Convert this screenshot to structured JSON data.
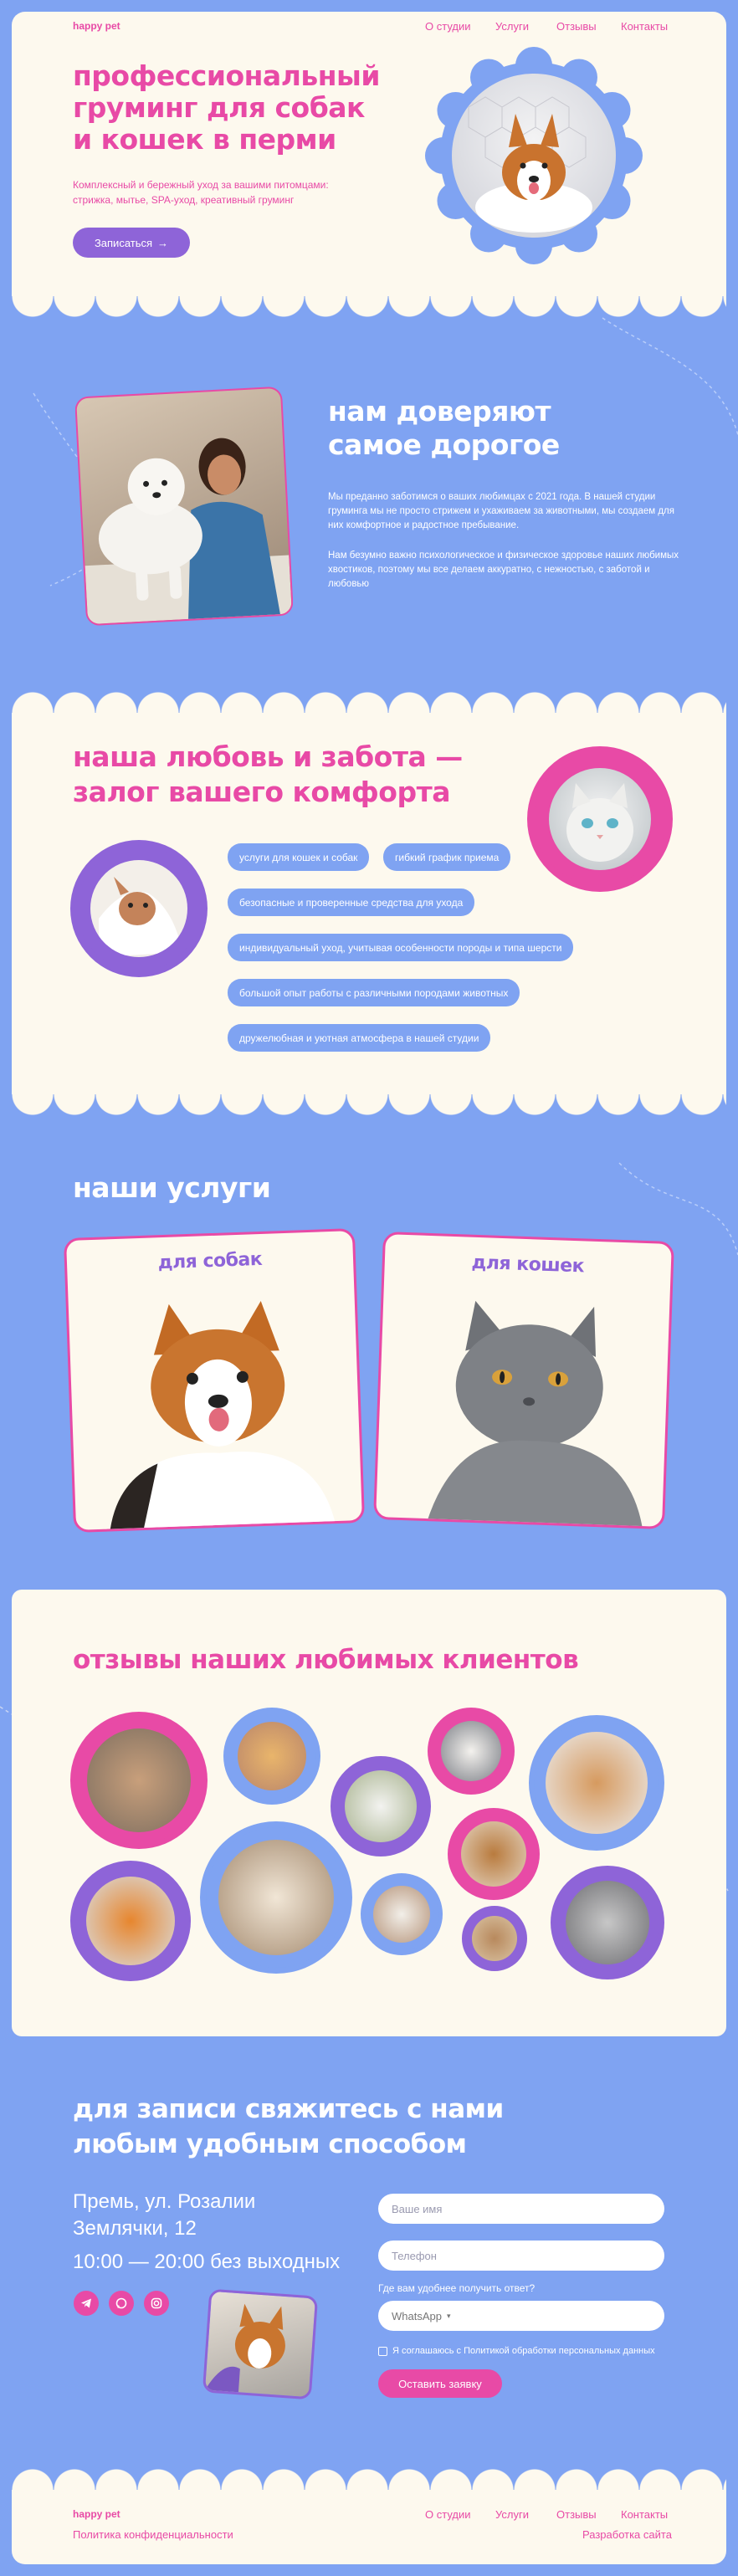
{
  "header": {
    "logo": "happy pet",
    "nav": [
      "О студии",
      "Услуги",
      "Отзывы",
      "Контакты"
    ]
  },
  "hero": {
    "title_lines": [
      "профессиональный",
      "груминг для собак",
      "и кошек в перми"
    ],
    "subtitle_lines": [
      "Комплексный и бережный уход за вашими питомцами:",
      "стрижка, мытье, SPA-уход, креативный груминг"
    ],
    "cta": "Записаться",
    "cta_icon": "arrow-right-icon"
  },
  "trust": {
    "title_lines": [
      "нам доверяют",
      "самое дорогое"
    ],
    "paragraph1": "Мы преданно заботимся о ваших любимцах с 2021 года. В нашей студии груминга мы не просто стрижем и ухаживаем за животными, мы создаем для них комфортное и радостное пребывание.",
    "paragraph2": "Нам безумно важно психологическое и физическое здоровье наших любимых хвостиков, поэтому мы все делаем аккуратно, с нежностью, с заботой и любовью"
  },
  "care": {
    "title_lines": [
      "наша любовь и забота —",
      "залог вашего комфорта"
    ],
    "chips": [
      "услуги для кошек и собак",
      "гибкий график приема",
      "безопасные и проверенные средства для ухода",
      "индивидуальный уход, учитывая особенности породы и типа шерсти",
      "большой опыт работы с различными породами животных",
      "дружелюбная и уютная атмосфера в нашей студии"
    ]
  },
  "services": {
    "title": "наши услуги",
    "cards": [
      "для собак",
      "для кошек"
    ]
  },
  "reviews": {
    "title": "отзывы наших любимых клиентов"
  },
  "contact": {
    "title_lines": [
      "для записи свяжитесь с нами",
      "любым удобным способом"
    ],
    "address_lines": [
      "Премь, ул. Розалии",
      "Землячки, 12"
    ],
    "hours": "10:00 — 20:00 без выходных",
    "form": {
      "name_placeholder": "Ваше имя",
      "phone_placeholder": "Телефон",
      "method_label": "Где вам удобнее получить ответ?",
      "method_value": "WhatsApp",
      "consent": "Я соглашаюсь с Политикой обработки персональных данных",
      "submit": "Оставить заявку"
    },
    "socials": [
      "telegram-icon",
      "whatsapp-icon",
      "instagram-icon"
    ]
  },
  "footer": {
    "logo": "happy pet",
    "nav": [
      "О студии",
      "Услуги",
      "Отзывы",
      "Контакты"
    ],
    "privacy": "Политика конфиденциальности",
    "developer": "Разработка сайта"
  },
  "colors": {
    "background": "#7fa3f2",
    "cream": "#fdf9ee",
    "pink": "#e84aa6",
    "purple": "#8e64d8"
  }
}
